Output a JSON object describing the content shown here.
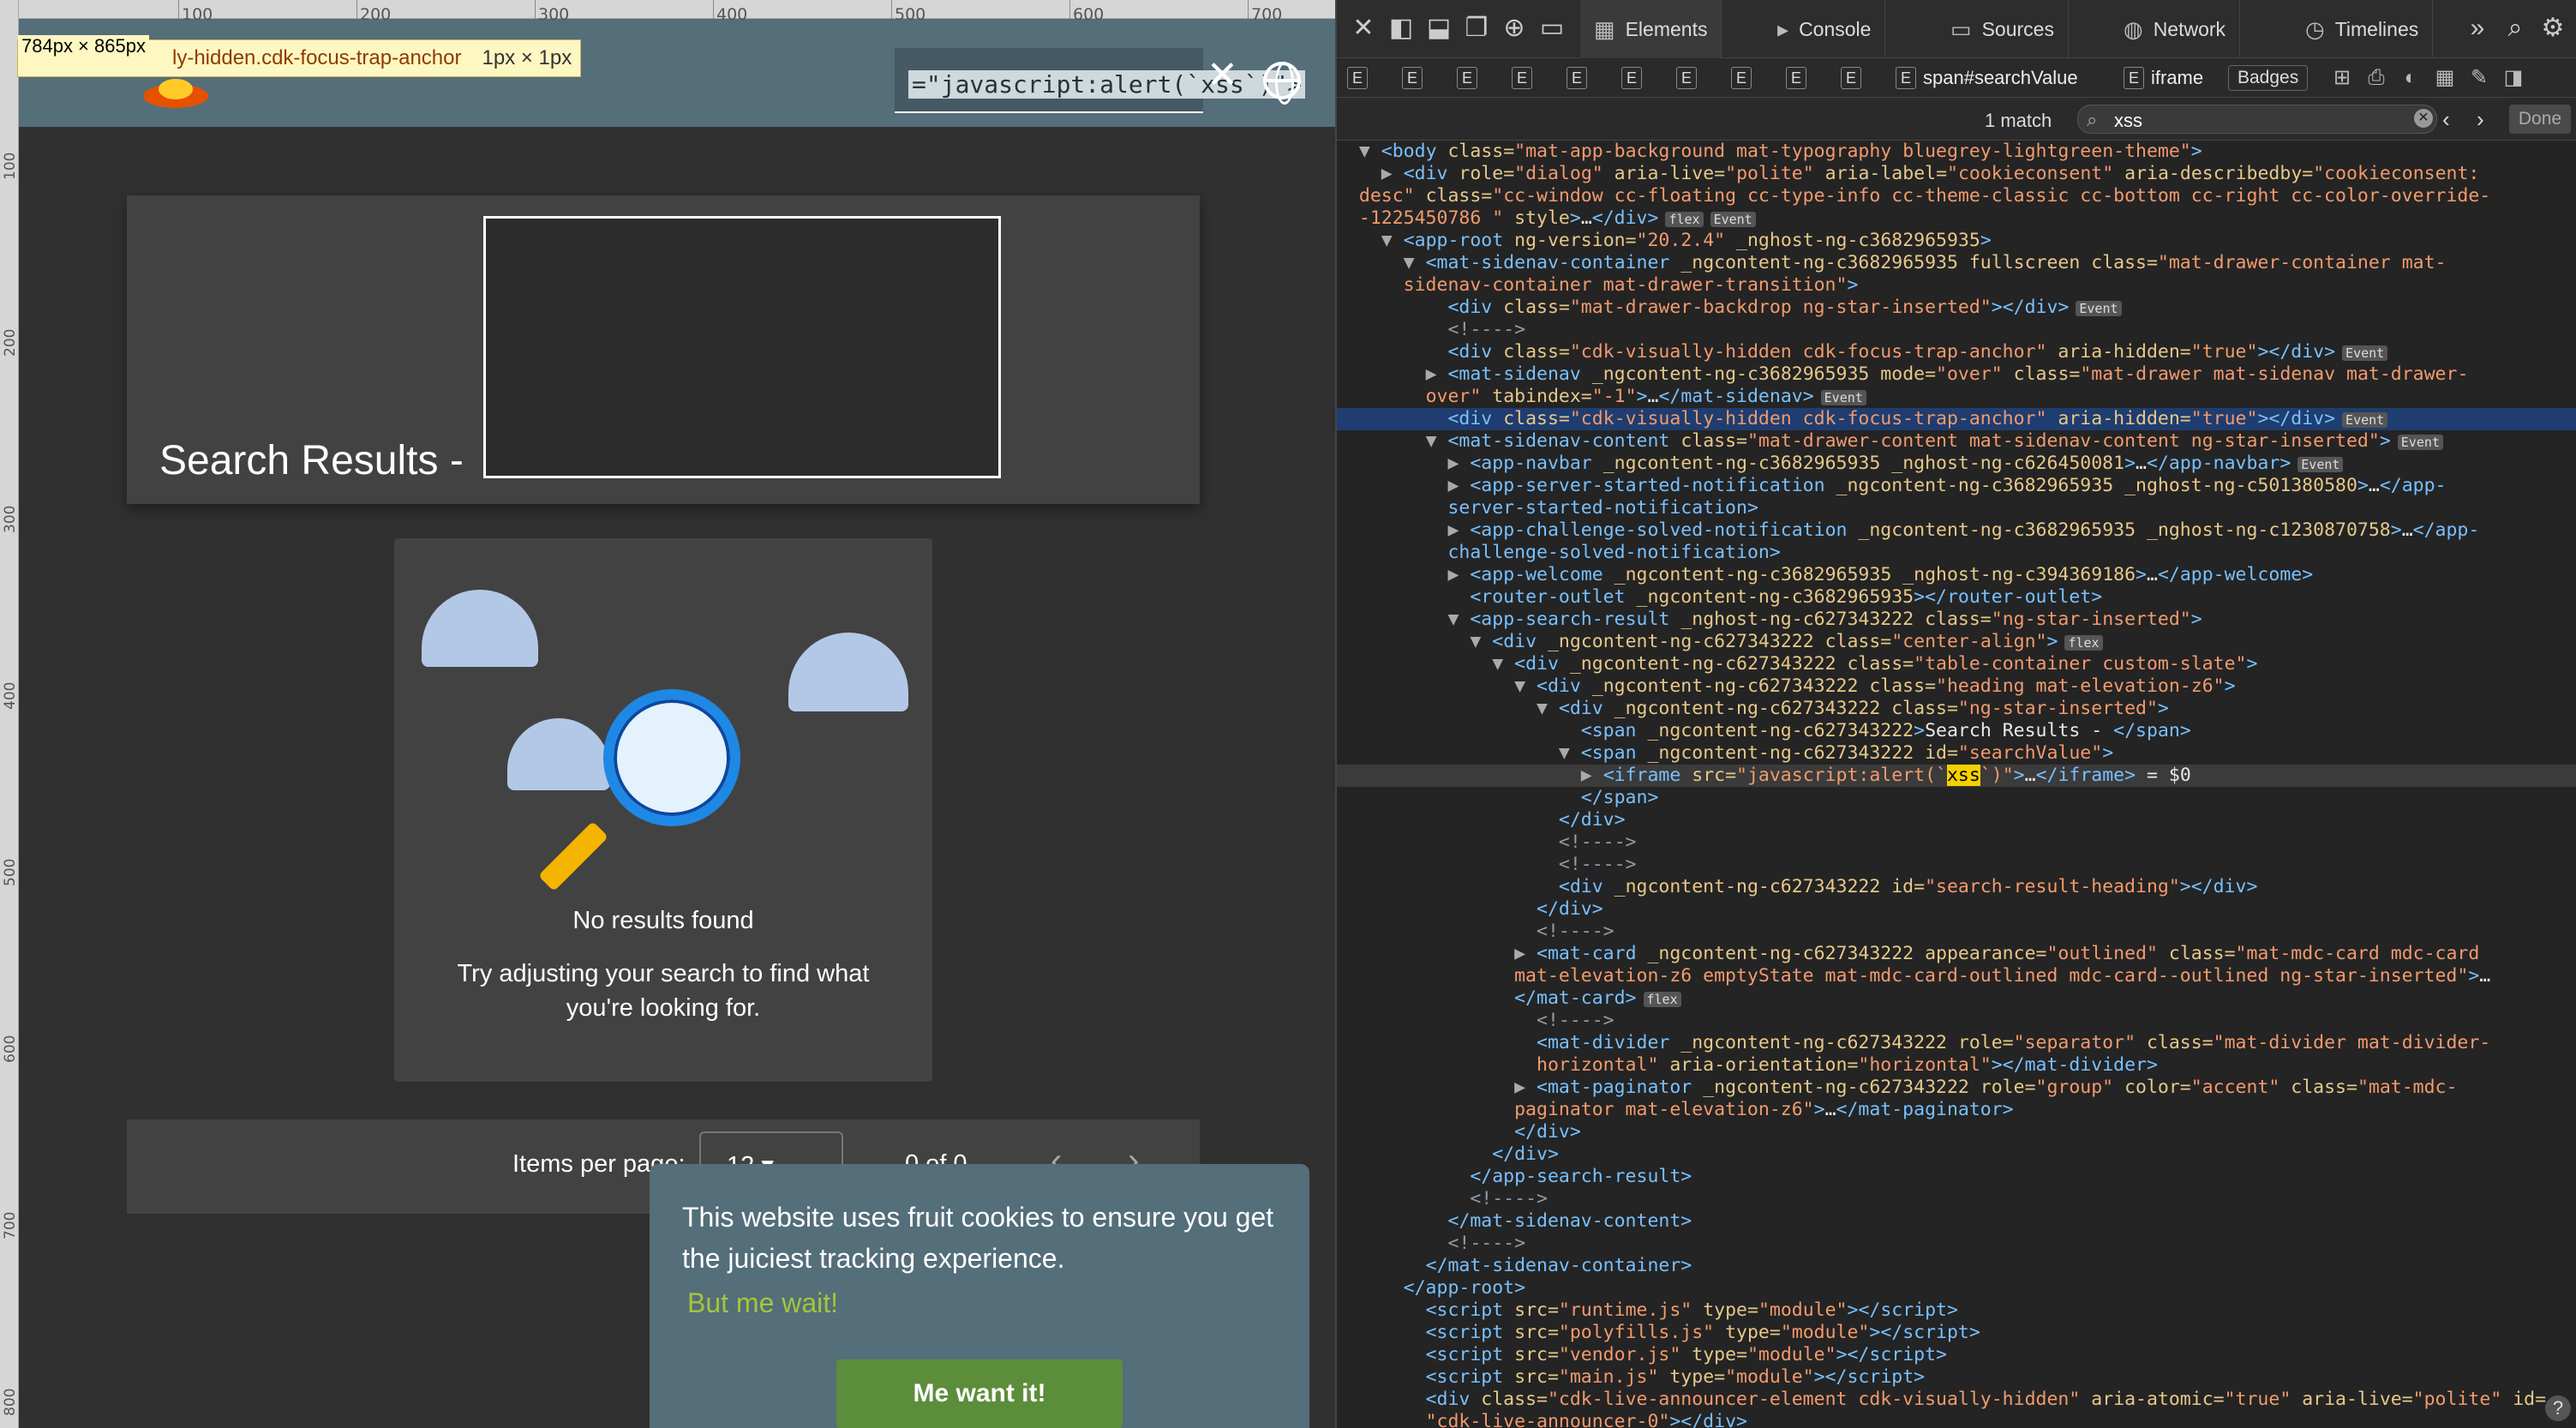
{
  "page": {
    "inspect_tooltip": {
      "size": "784px × 865px",
      "selector": "ly-hidden.cdk-focus-trap-anchor",
      "dimensions": "1px × 1px"
    },
    "ruler_top": [
      "100",
      "200",
      "300",
      "400",
      "500",
      "600",
      "700"
    ],
    "ruler_left": [
      "100",
      "200",
      "300",
      "400",
      "500",
      "600",
      "700",
      "800"
    ],
    "search_value": "=\"javascript:alert(`xss`)\">",
    "heading": "Search Results -",
    "empty_title": "No results found",
    "empty_desc": "Try adjusting your search to find what you're looking for.",
    "paginator": {
      "items_label": "Items per page:",
      "items_value": "12",
      "range": "0 of 0"
    },
    "cookie": {
      "message": "This website uses fruit cookies to ensure you get the juiciest tracking experience.",
      "link": "But me wait!",
      "button": "Me want it!"
    }
  },
  "devtools": {
    "tabs": [
      {
        "label": "Elements",
        "icon": "▦"
      },
      {
        "label": "Console",
        "icon": "▸"
      },
      {
        "label": "Sources",
        "icon": "▭"
      },
      {
        "label": "Network",
        "icon": "◍"
      },
      {
        "label": "Timelines",
        "icon": "◷"
      }
    ],
    "crumbs": [
      "E",
      "E",
      "E",
      "E",
      "E",
      "E",
      "E",
      "E",
      "E",
      "E"
    ],
    "crumb_span": "span#searchValue",
    "crumb_iframe": "iframe",
    "badges_label": "Badges",
    "find": {
      "match_count": "1 match",
      "query": "xss",
      "done": "Done"
    }
  }
}
